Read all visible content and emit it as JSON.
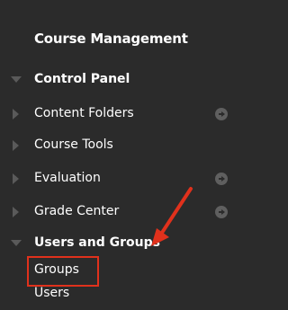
{
  "menu": {
    "title": "Course Management",
    "items": [
      {
        "label": "Control Panel",
        "expanded": true,
        "bold": true,
        "go_icon": false
      },
      {
        "label": "Content Folders",
        "expanded": false,
        "bold": false,
        "go_icon": true
      },
      {
        "label": "Course Tools",
        "expanded": false,
        "bold": false,
        "go_icon": false
      },
      {
        "label": "Evaluation",
        "expanded": false,
        "bold": false,
        "go_icon": true
      },
      {
        "label": "Grade Center",
        "expanded": false,
        "bold": false,
        "go_icon": true
      },
      {
        "label": "Users and Groups",
        "expanded": true,
        "bold": true,
        "go_icon": false
      }
    ],
    "subitems": [
      {
        "label": "Groups",
        "highlighted": true
      },
      {
        "label": "Users",
        "highlighted": false
      }
    ]
  },
  "annotation": {
    "highlight_color": "#e0311c",
    "arrow_color": "#e0311c"
  },
  "colors": {
    "background": "#2b2b2b",
    "text": "#ffffff",
    "arrow": "#5a5a5a"
  }
}
